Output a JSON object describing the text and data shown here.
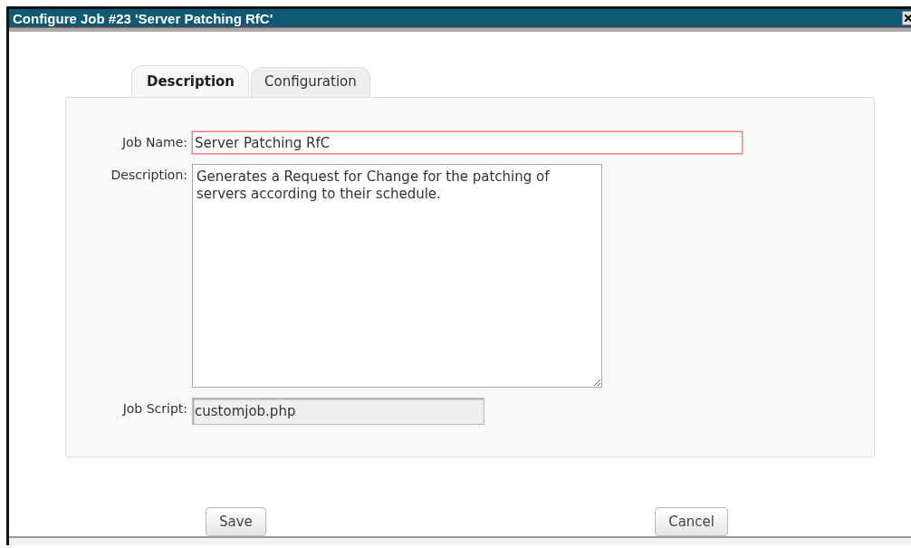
{
  "window": {
    "title": "Configure Job #23 'Server Patching RfC'"
  },
  "tabs": [
    {
      "label": "Description",
      "selected": true
    },
    {
      "label": "Configuration",
      "selected": false
    }
  ],
  "form": {
    "fields": [
      {
        "kind": "text",
        "label": "Job Name:",
        "value": "Server Patching RfC",
        "invalid": true
      },
      {
        "kind": "textarea",
        "label": "Description:",
        "value": "Generates a Request for Change for the patching of servers according to their schedule."
      },
      {
        "kind": "readonly",
        "label": "Job Script:",
        "value": "customjob.php"
      }
    ]
  },
  "buttons": [
    {
      "label": "Save"
    },
    {
      "label": "Cancel"
    }
  ]
}
